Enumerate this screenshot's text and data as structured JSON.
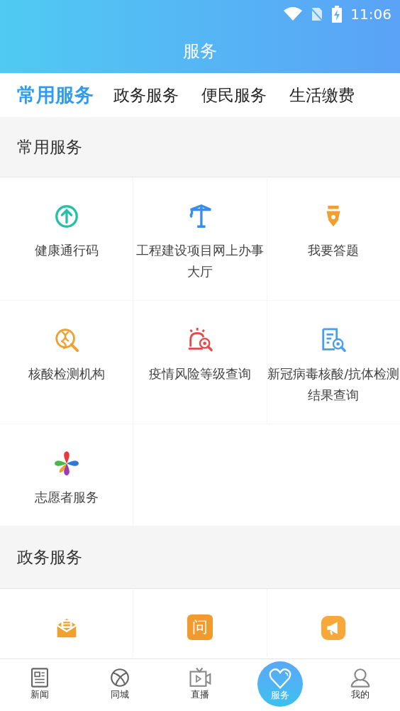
{
  "status_bar": {
    "time": "11:06"
  },
  "header": {
    "title": "服务"
  },
  "tabs": [
    {
      "label": "常用服务",
      "selected": true
    },
    {
      "label": "政务服务",
      "selected": false
    },
    {
      "label": "便民服务",
      "selected": false
    },
    {
      "label": "生活缴费",
      "selected": false
    }
  ],
  "sections": [
    {
      "title": "常用服务",
      "items": [
        {
          "label": "健康通行码"
        },
        {
          "label": "工程建设项目网上办事大厅"
        },
        {
          "label": "我要答题"
        },
        {
          "label": "核酸检测机构"
        },
        {
          "label": "疫情风险等级查询"
        },
        {
          "label": "新冠病毒核酸/抗体检测结果查询"
        },
        {
          "label": "志愿者服务"
        }
      ]
    },
    {
      "title": "政务服务",
      "items": [
        {
          "kind": "icon"
        },
        {
          "kind": "glyph",
          "glyph": "问"
        },
        {
          "kind": "icon"
        }
      ]
    }
  ],
  "bottom_nav": [
    {
      "label": "新闻",
      "selected": false
    },
    {
      "label": "同城",
      "selected": false
    },
    {
      "label": "直播",
      "selected": false
    },
    {
      "label": "服务",
      "selected": true
    },
    {
      "label": "我的",
      "selected": false
    }
  ]
}
